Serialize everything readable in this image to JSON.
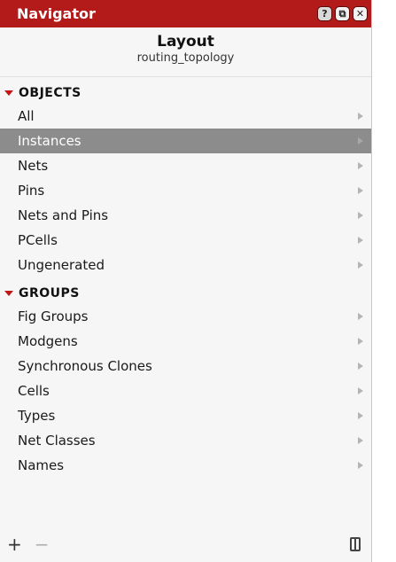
{
  "window": {
    "title": "Navigator",
    "buttons": {
      "help": "?",
      "float": "⧉",
      "close": "✕"
    }
  },
  "header": {
    "title": "Layout",
    "subtitle": "routing_topology"
  },
  "sections": [
    {
      "label": "OBJECTS",
      "items": [
        {
          "label": "All",
          "selected": false
        },
        {
          "label": "Instances",
          "selected": true
        },
        {
          "label": "Nets",
          "selected": false
        },
        {
          "label": "Pins",
          "selected": false
        },
        {
          "label": "Nets and Pins",
          "selected": false
        },
        {
          "label": "PCells",
          "selected": false
        },
        {
          "label": "Ungenerated",
          "selected": false
        }
      ]
    },
    {
      "label": "GROUPS",
      "items": [
        {
          "label": "Fig Groups",
          "selected": false
        },
        {
          "label": "Modgens",
          "selected": false
        },
        {
          "label": "Synchronous Clones",
          "selected": false
        },
        {
          "label": "Cells",
          "selected": false
        },
        {
          "label": "Types",
          "selected": false
        },
        {
          "label": "Net Classes",
          "selected": false
        },
        {
          "label": "Names",
          "selected": false
        }
      ]
    }
  ],
  "footer": {
    "add": "+",
    "remove": "−"
  },
  "icons": {
    "section_caret": "caret-down-icon",
    "item_arrow": "chevron-right-icon",
    "panel_toggle": "panel-toggle-icon"
  },
  "colors": {
    "titlebar": "#b31a1a",
    "selected_row": "#8c8c8c",
    "caret": "#c01717"
  }
}
